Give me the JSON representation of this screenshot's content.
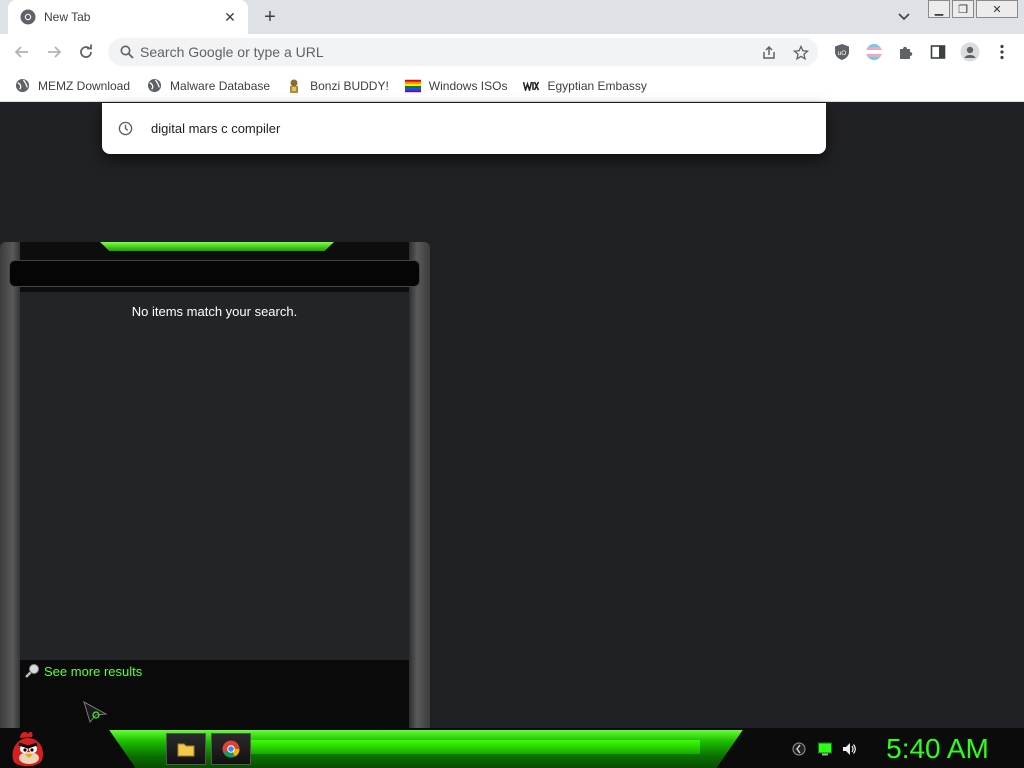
{
  "browser": {
    "tab": {
      "title": "New Tab"
    },
    "omnibox": {
      "placeholder": "Search Google or type a URL"
    },
    "bookmarks": [
      {
        "label": "MEMZ Download",
        "icon": "globe-icon"
      },
      {
        "label": "Malware Database",
        "icon": "globe-icon"
      },
      {
        "label": "Bonzi BUDDY!",
        "icon": "bonzi-icon"
      },
      {
        "label": "Windows ISOs",
        "icon": "rainbow-flag-icon"
      },
      {
        "label": "Egyptian Embassy",
        "icon": "wix-icon"
      }
    ],
    "suggestion": {
      "text": "digital mars c compiler",
      "icon": "history-clock-icon"
    }
  },
  "start_menu": {
    "no_results": "No items match your search.",
    "see_more": "See more results"
  },
  "taskbar": {
    "clock": "5:40 AM"
  },
  "colors": {
    "accent_green": "#2eff1a",
    "page_bg": "#202124"
  }
}
